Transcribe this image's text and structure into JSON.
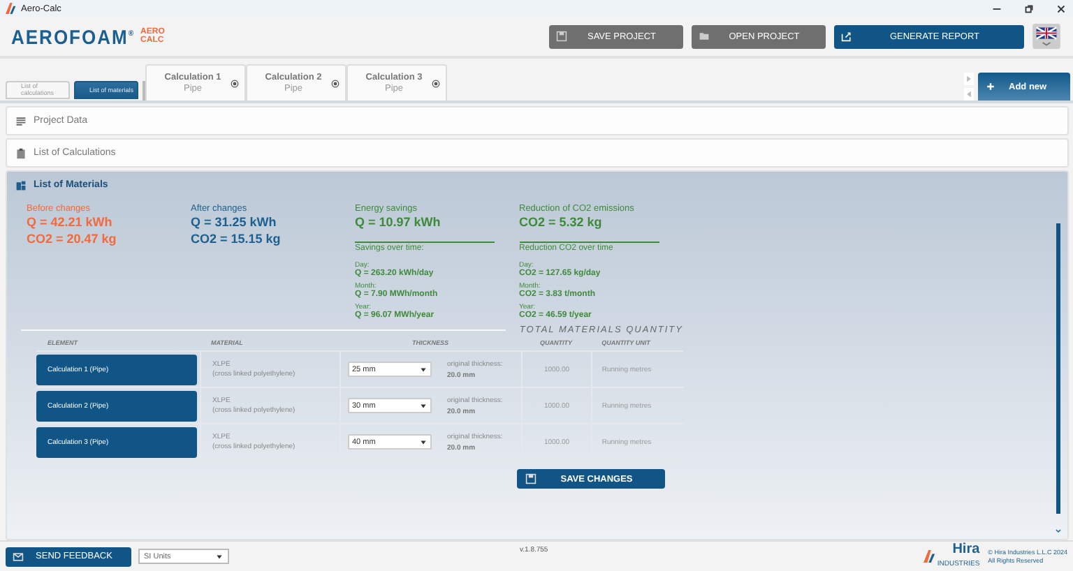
{
  "window": {
    "title": "Aero-Calc"
  },
  "header": {
    "logo": {
      "brand": "AEROFOAM",
      "mark": "®",
      "line1": "AERO",
      "line2": "CALC"
    },
    "buttons": [
      {
        "label": "SAVE PROJECT",
        "kind": "secondary"
      },
      {
        "label": "OPEN PROJECT",
        "kind": "secondary"
      },
      {
        "label": "GENERATE REPORT",
        "kind": "primary"
      }
    ]
  },
  "view_tabs": [
    {
      "label": "List of calculations",
      "selected": false
    },
    {
      "label": "List of materials",
      "selected": true
    }
  ],
  "calc_tabs": [
    {
      "title": "Calculation 1",
      "subtitle": "Pipe"
    },
    {
      "title": "Calculation 2",
      "subtitle": "Pipe"
    },
    {
      "title": "Calculation 3",
      "subtitle": "Pipe"
    }
  ],
  "add_button": "Add new",
  "sections": [
    {
      "title": "Project Data",
      "expanded": false
    },
    {
      "title": "List of Calculations",
      "expanded": false
    },
    {
      "title": "List of Materials",
      "expanded": true
    }
  ],
  "summary": [
    {
      "label": "Before changes",
      "color": "#f06a3c",
      "values": [
        "Q = 42.21 kWh",
        "CO2 = 20.47 kg"
      ]
    },
    {
      "label": "After changes",
      "color": "#1d5f8e",
      "values": [
        "Q = 31.25 kWh",
        "CO2 = 15.15 kg"
      ]
    },
    {
      "label": "Energy savings",
      "color": "#3f8a3a",
      "values": [
        "Q = 10.97 kWh"
      ],
      "over_time": {
        "title": "Savings over time:",
        "periods": [
          {
            "label": "Day:",
            "value": "Q = 263.20 kWh/day"
          },
          {
            "label": "Month:",
            "value": "Q = 7.90 MWh/month"
          },
          {
            "label": "Year:",
            "value": "Q = 96.07 MWh/year"
          }
        ]
      }
    },
    {
      "label": "Reduction of CO2 emissions",
      "color": "#3f8a3a",
      "values": [
        "CO2 = 5.32 kg"
      ],
      "over_time": {
        "title": "Reduction CO2 over time",
        "periods": [
          {
            "label": "Day:",
            "value": "CO2 = 127.65 kg/day"
          },
          {
            "label": "Month:",
            "value": "CO2 = 3.83 t/month"
          },
          {
            "label": "Year:",
            "value": "CO2 = 46.59 t/year"
          }
        ]
      }
    }
  ],
  "table": {
    "title": "TOTAL MATERIALS QUANTITY",
    "columns": [
      "ELEMENT",
      "MATERIAL",
      "THICKNESS",
      "QUANTITY",
      "QUANTITY UNIT"
    ],
    "rows": [
      {
        "element": "Calculation 1 (Pipe)",
        "material": "XLPE",
        "material_detail": "(cross linked polyethylene)",
        "thickness": "25 mm",
        "original_label": "original thickness:",
        "original_value": "20.0 mm",
        "quantity": "1000.00",
        "unit": "Running metres"
      },
      {
        "element": "Calculation 2 (Pipe)",
        "material": "XLPE",
        "material_detail": "(cross linked polyethylene)",
        "thickness": "30 mm",
        "original_label": "original thickness:",
        "original_value": "20.0 mm",
        "quantity": "1000.00",
        "unit": "Running metres"
      },
      {
        "element": "Calculation 3 (Pipe)",
        "material": "XLPE",
        "material_detail": "(cross linked polyethylene)",
        "thickness": "40 mm",
        "original_label": "original thickness:",
        "original_value": "20.0 mm",
        "quantity": "1000.00",
        "unit": "Running metres"
      }
    ]
  },
  "save_changes": "SAVE CHANGES",
  "footer": {
    "feedback": "SEND FEEDBACK",
    "units": "SI Units",
    "version": "v.1.8.755",
    "company_logo": "Hira",
    "company_sub": "INDUSTRIES",
    "copyright": "© Hira Industries L.L.C 2024",
    "rights": "All Rights Reserved"
  }
}
